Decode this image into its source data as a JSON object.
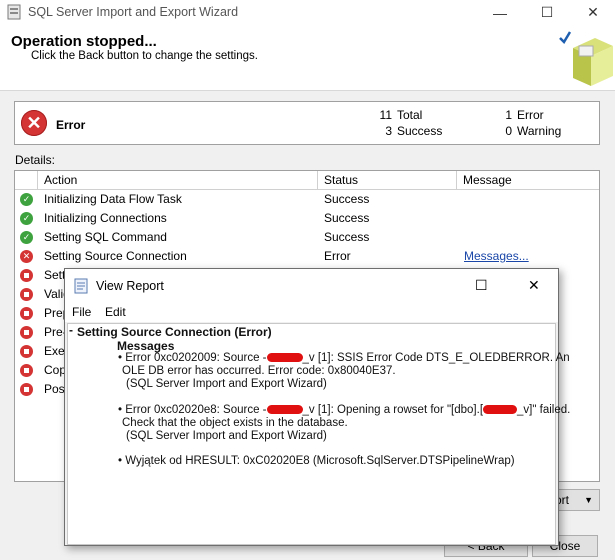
{
  "window": {
    "title": "SQL Server Import and Export Wizard",
    "minimize": "—",
    "maximize": "☐",
    "close": "✕"
  },
  "header": {
    "title": "Operation stopped...",
    "subtitle": "Click the Back button to change the settings."
  },
  "summary": {
    "status": "Error",
    "total_count": "11",
    "total_label": "Total",
    "success_count": "3",
    "success_label": "Success",
    "error_count": "1",
    "error_label": "Error",
    "warning_count": "0",
    "warning_label": "Warning"
  },
  "details": {
    "label": "Details:",
    "columns": [
      "Action",
      "Status",
      "Message"
    ],
    "rows": [
      {
        "action": "Initializing Data Flow Task",
        "status": "Success",
        "message": "",
        "icon": "success-icon"
      },
      {
        "action": "Initializing Connections",
        "status": "Success",
        "message": "",
        "icon": "success-icon"
      },
      {
        "action": "Setting SQL Command",
        "status": "Success",
        "message": "",
        "icon": "success-icon"
      },
      {
        "action": "Setting Source Connection",
        "status": "Error",
        "message": "Messages...",
        "icon": "error-icon"
      },
      {
        "action": "Setti",
        "status": "",
        "message": "",
        "icon": "stopped-icon"
      },
      {
        "action": "Valid",
        "status": "",
        "message": "",
        "icon": "stopped-icon"
      },
      {
        "action": "Prep",
        "status": "",
        "message": "",
        "icon": "stopped-icon"
      },
      {
        "action": "Pre-",
        "status": "",
        "message": "",
        "icon": "stopped-icon"
      },
      {
        "action": "Exec",
        "status": "",
        "message": "",
        "icon": "stopped-icon"
      },
      {
        "action": "Copy",
        "status": "",
        "message": "",
        "icon": "stopped-icon"
      },
      {
        "action": "Post",
        "status": "",
        "message": "",
        "icon": "stopped-icon"
      }
    ]
  },
  "buttons": {
    "report": "ort",
    "report_arrow": "▼",
    "back": "< Back",
    "close": "Close"
  },
  "dialog": {
    "title": "View Report",
    "maximize": "☐",
    "close": "✕",
    "menu": [
      "File",
      "Edit"
    ],
    "section_title": "Setting Source Connection (Error)",
    "messages_heading": "Messages",
    "msg1_line1_a": "• Error 0xc0202009: Source -",
    "msg1_line1_b": "_v [1]: SSIS Error Code DTS_E_OLEDBERROR.  An",
    "msg1_line2": "OLE DB error has occurred. Error code: 0x80040E37.",
    "msg1_line3": "(SQL Server Import and Export Wizard)",
    "msg2_line1_a": "• Error 0xc02020e8: Source -",
    "msg2_line1_b": "_v [1]: Opening a rowset for \"[dbo].[",
    "msg2_line1_c": "_v]\" failed.",
    "msg2_line2": "Check that the object exists in the database.",
    "msg2_line3": "(SQL Server Import and Export Wizard)",
    "msg3_line1": "• Wyjątek od HRESULT: 0xC02020E8 (Microsoft.SqlServer.DTSPipelineWrap)"
  }
}
